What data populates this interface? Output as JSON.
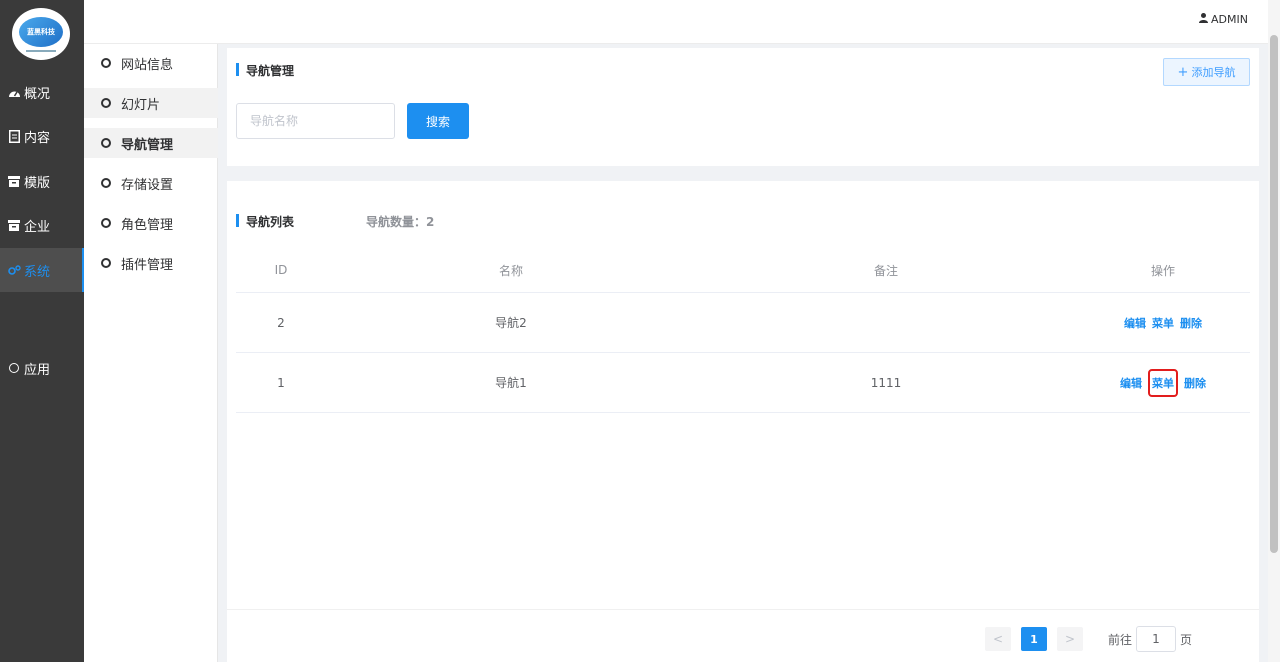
{
  "sidebar": {
    "logo_text": "蓝黑科技",
    "items": [
      {
        "label": "概况",
        "icon": "dashboard-icon"
      },
      {
        "label": "内容",
        "icon": "document-icon"
      },
      {
        "label": "模版",
        "icon": "template-icon"
      },
      {
        "label": "企业",
        "icon": "enterprise-icon"
      },
      {
        "label": "系统",
        "icon": "settings-icon",
        "active": true
      },
      {
        "label": "应用",
        "icon": "circle-icon"
      }
    ]
  },
  "header": {
    "user": "ADMIN",
    "user_icon": "user-icon"
  },
  "submenu": {
    "items": [
      {
        "label": "网站信息"
      },
      {
        "label": "幻灯片"
      },
      {
        "label": "导航管理",
        "active": true
      },
      {
        "label": "存储设置"
      },
      {
        "label": "角色管理"
      },
      {
        "label": "插件管理"
      }
    ]
  },
  "search_panel": {
    "title": "导航管理",
    "add_button": "添加导航",
    "search_placeholder": "导航名称",
    "search_value": "",
    "search_button": "搜索"
  },
  "list_panel": {
    "title": "导航列表",
    "count_text": "导航数量：2",
    "columns": [
      "ID",
      "名称",
      "备注",
      "操作"
    ],
    "rows": [
      {
        "id": "2",
        "name": "导航2",
        "note": "",
        "actions": [
          "编辑",
          "菜单",
          "删除"
        ]
      },
      {
        "id": "1",
        "name": "导航1",
        "note": "1111",
        "actions": [
          "编辑",
          "菜单",
          "删除"
        ]
      }
    ]
  },
  "pagination": {
    "prev": "<",
    "next": ">",
    "current_page": "1",
    "goto_prefix": "前往",
    "goto_value": "1",
    "goto_suffix": "页"
  },
  "colors": {
    "accent": "#1d8ff0",
    "sidebar_bg": "#3a3a3a",
    "highlight_box": "#e21d1d"
  }
}
